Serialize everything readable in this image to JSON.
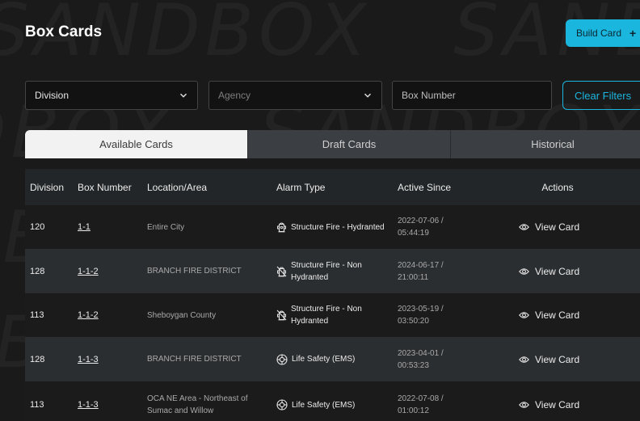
{
  "watermark": "SANDBOX",
  "page_title": "Box Cards",
  "build_button": {
    "label": "Build Card",
    "icon": "plus-icon"
  },
  "filters": {
    "division": {
      "label": "Division"
    },
    "agency": {
      "label": "Agency"
    },
    "box_number": {
      "placeholder": "Box Number"
    },
    "clear_label": "Clear Filters"
  },
  "tabs": [
    {
      "label": "Available Cards",
      "active": true
    },
    {
      "label": "Draft Cards",
      "active": false
    },
    {
      "label": "Historical",
      "active": false
    }
  ],
  "table": {
    "headers": {
      "division": "Division",
      "box_number": "Box Number",
      "location": "Location/Area",
      "alarm_type": "Alarm Type",
      "active_since": "Active Since",
      "actions": "Actions"
    },
    "rows": [
      {
        "division": "120",
        "box": "1-1",
        "location": "Entire City",
        "alarm": "Structure Fire - Hydranted",
        "alarm_icon": "hydrant-icon",
        "date": "2022-07-06 /",
        "time": "05:44:19",
        "action": "View Card"
      },
      {
        "division": "128",
        "box": "1-1-2",
        "location": "BRANCH FIRE DISTRICT",
        "alarm": "Structure Fire - Non Hydranted",
        "alarm_icon": "hydrant-off-icon",
        "date": "2024-06-17 /",
        "time": "21:00:11",
        "action": "View Card"
      },
      {
        "division": "113",
        "box": "1-1-2",
        "location": "Sheboygan County",
        "alarm": "Structure Fire - Non Hydranted",
        "alarm_icon": "hydrant-off-icon",
        "date": "2023-05-19 /",
        "time": "03:50:20",
        "action": "View Card"
      },
      {
        "division": "128",
        "box": "1-1-3",
        "location": "BRANCH FIRE DISTRICT",
        "alarm": "Life Safety (EMS)",
        "alarm_icon": "life-safety-icon",
        "date": "2023-04-01 /",
        "time": "00:53:23",
        "action": "View Card"
      },
      {
        "division": "113",
        "box": "1-1-3",
        "location": "OCA NE Area - Northeast of Sumac and Willow",
        "alarm": "Life Safety (EMS)",
        "alarm_icon": "life-safety-icon",
        "date": "2022-07-08 /",
        "time": "01:00:12",
        "action": "View Card"
      }
    ]
  }
}
